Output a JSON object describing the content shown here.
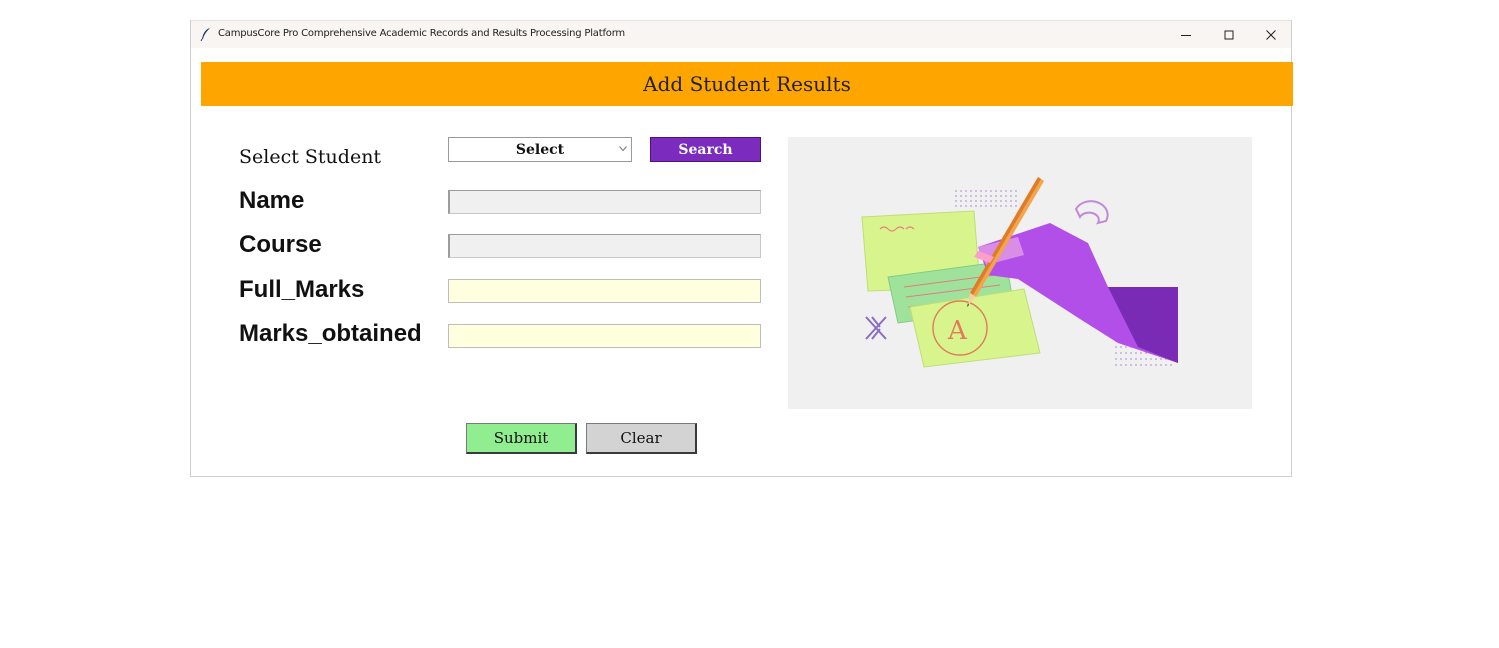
{
  "window": {
    "title": "CampusCore Pro Comprehensive Academic Records and Results Processing Platform",
    "icon": "feather-icon",
    "controls": [
      "minimize-icon",
      "maximize-icon",
      "close-icon"
    ]
  },
  "header": {
    "title": "Add Student Results",
    "color": "#ffa500"
  },
  "form": {
    "select_student_label": "Select Student",
    "select_value": "Select",
    "search_label": "Search",
    "search_color": "#7b2cbf",
    "name_label": "Name",
    "name_value": "",
    "course_label": "Course",
    "course_value": "",
    "full_marks_label": "Full_Marks",
    "full_marks_value": "",
    "marks_obtained_label": "Marks_obtained",
    "marks_obtained_value": ""
  },
  "illustration": {
    "icon": "hand-writing-grade-illustration",
    "grade_letter": "A"
  },
  "actions": {
    "submit_label": "Submit",
    "submit_color": "#90ee90",
    "clear_label": "Clear",
    "clear_color": "#d3d3d3"
  }
}
